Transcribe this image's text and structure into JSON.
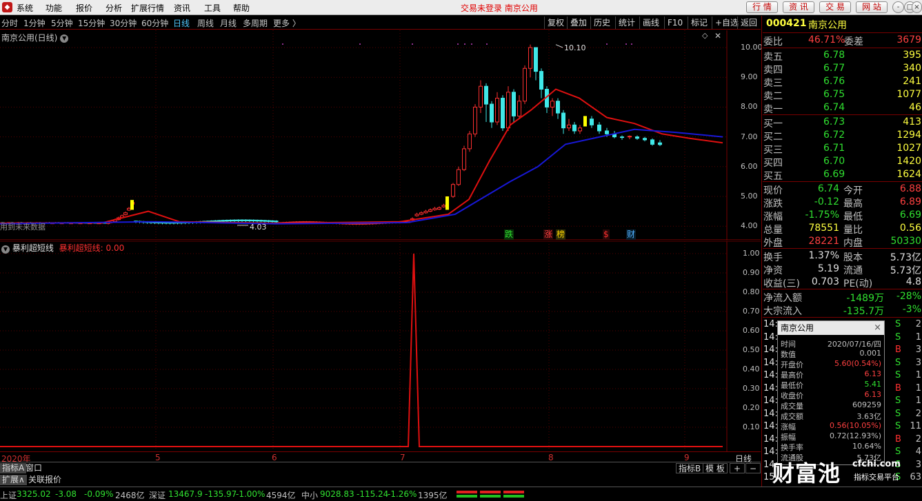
{
  "menubar": {
    "items": [
      "系统",
      "功能",
      "报价",
      "分析",
      "扩展行情",
      "资讯",
      "工具",
      "帮助"
    ],
    "notice": "交易未登录  南京公用",
    "right_buttons": [
      "行 情",
      "资 讯",
      "交 易",
      "网 站"
    ],
    "window_buttons": [
      "-",
      "□",
      "×"
    ]
  },
  "toolbar": {
    "periods": [
      "分时",
      "1分钟",
      "5分钟",
      "15分钟",
      "30分钟",
      "60分钟",
      "日线",
      "周线",
      "月线",
      "多周期",
      "更多 〉"
    ],
    "active_period": "日线",
    "tools": [
      "复权",
      "叠加",
      "历史",
      "统计",
      "画线",
      "F10",
      "标记",
      "+自选",
      "返回"
    ]
  },
  "main_chart": {
    "title": "南京公用(日线)",
    "no_future_data": "用到未来数据",
    "high_label": "10.10",
    "low_label": "4.03",
    "y_labels": [
      "10.00",
      "9.00",
      "8.00",
      "7.00",
      "6.00",
      "5.00",
      "4.00"
    ],
    "event_tags": [
      {
        "text": "跌",
        "color": "#30e030"
      },
      {
        "text": "涨",
        "color": "#ff4040"
      },
      {
        "text": "榜",
        "color": "#ffd700"
      },
      {
        "text": "$",
        "color": "#ff3030"
      },
      {
        "text": "财",
        "color": "#50b0ff"
      }
    ],
    "diamond_icon": "◇",
    "close_icon": "✕"
  },
  "indicator": {
    "name": "暴利超短线",
    "series_label": "暴利超短线: 0.00",
    "y_labels": [
      "1.00",
      "0.90",
      "0.80",
      "0.70",
      "0.60",
      "0.50",
      "0.40",
      "0.30",
      "0.20",
      "0.10"
    ]
  },
  "chart_data": [
    {
      "type": "candlestick",
      "title": "南京公用(日线)",
      "ylim": [
        3.75,
        10.3
      ],
      "ma_colors": {
        "short": "#e01010",
        "long": "#1010d0"
      },
      "annotations": {
        "max": 10.1,
        "min": 4.03
      }
    },
    {
      "type": "line",
      "title": "暴利超短线",
      "ylim": [
        0,
        1.05
      ],
      "peak": 1.0,
      "baseline": 0.0,
      "color": "#e01010"
    }
  ],
  "time_axis": [
    "2020年",
    "5",
    "6",
    "7",
    "8",
    "9"
  ],
  "time_axis_right": "日线",
  "bottom_tabs": [
    "指标A",
    "窗口"
  ],
  "bottom_tabs_right": [
    "指标B",
    "模 板",
    "+",
    "−"
  ],
  "bottom_tabs2": [
    "扩展∧",
    "关联报价"
  ],
  "right_panel": {
    "code": "000421",
    "name": "南京公用",
    "weibi_label": "委比",
    "weibi": "46.71%",
    "weicha_label": "委差",
    "weicha": "3679",
    "sells": [
      {
        "label": "卖五",
        "price": "6.78",
        "vol": "395"
      },
      {
        "label": "卖四",
        "price": "6.77",
        "vol": "340"
      },
      {
        "label": "卖三",
        "price": "6.76",
        "vol": "241"
      },
      {
        "label": "卖二",
        "price": "6.75",
        "vol": "1077"
      },
      {
        "label": "卖一",
        "price": "6.74",
        "vol": "46"
      }
    ],
    "buys": [
      {
        "label": "买一",
        "price": "6.73",
        "vol": "413"
      },
      {
        "label": "买二",
        "price": "6.72",
        "vol": "1294"
      },
      {
        "label": "买三",
        "price": "6.71",
        "vol": "1027"
      },
      {
        "label": "买四",
        "price": "6.70",
        "vol": "1420"
      },
      {
        "label": "买五",
        "price": "6.69",
        "vol": "1624"
      }
    ],
    "quote": [
      {
        "l1": "现价",
        "v1": "6.74",
        "c1": "#30e030",
        "l2": "今开",
        "v2": "6.88",
        "c2": "#ff4040"
      },
      {
        "l1": "涨跌",
        "v1": "-0.12",
        "c1": "#30e030",
        "l2": "最高",
        "v2": "6.89",
        "c2": "#ff4040"
      },
      {
        "l1": "涨幅",
        "v1": "-1.75%",
        "c1": "#30e030",
        "l2": "最低",
        "v2": "6.69",
        "c2": "#30e030"
      },
      {
        "l1": "总量",
        "v1": "78551",
        "c1": "#ffff40",
        "l2": "量比",
        "v2": "0.56",
        "c2": "#ffff40"
      },
      {
        "l1": "外盘",
        "v1": "28221",
        "c1": "#ff4040",
        "l2": "内盘",
        "v2": "50330",
        "c2": "#30e030"
      }
    ],
    "fund": [
      {
        "l1": "换手",
        "v1": "1.37%",
        "l2": "股本",
        "v2": "5.73亿"
      },
      {
        "l1": "净资",
        "v1": "5.19",
        "l2": "流通",
        "v2": "5.73亿"
      },
      {
        "l1": "收益(三)",
        "v1": "0.703",
        "l2": "PE(动)",
        "v2": "4.8"
      }
    ],
    "flow": [
      {
        "label": "净流入额",
        "v1": "-1489万",
        "v2": "-28%"
      },
      {
        "label": "大宗流入",
        "v1": "-135.7万",
        "v2": "-3%"
      }
    ],
    "trades": [
      {
        "t": "14:",
        "s": "S",
        "n": "2"
      },
      {
        "t": "14:",
        "s": "S",
        "n": "1"
      },
      {
        "t": "14:",
        "s": "B",
        "n": "3"
      },
      {
        "t": "14:",
        "s": "S",
        "n": "3"
      },
      {
        "t": "14:",
        "s": "S",
        "n": "1"
      },
      {
        "t": "14:",
        "s": "B",
        "n": "1"
      },
      {
        "t": "14:",
        "s": "S",
        "n": "1"
      },
      {
        "t": "14:",
        "s": "S",
        "n": "2"
      },
      {
        "t": "14:",
        "s": "S",
        "n": "11"
      },
      {
        "t": "14:",
        "s": "B",
        "n": "2"
      },
      {
        "t": "14:",
        "s": "S",
        "n": "4"
      },
      {
        "t": "14:",
        "s": "S",
        "n": "3"
      },
      {
        "t": "15",
        "s": "S",
        "n": "63"
      }
    ]
  },
  "popup": {
    "title": "南京公用",
    "rows": [
      {
        "k": "时间",
        "v": "2020/07/16/四",
        "c": "#c0c0c0"
      },
      {
        "k": "数值",
        "v": "0.001",
        "c": "#c0c0c0"
      },
      {
        "k": "开盘价",
        "v": "5.60(0.54%)",
        "c": "#ff4040"
      },
      {
        "k": "最高价",
        "v": "6.13",
        "c": "#ff4040"
      },
      {
        "k": "最低价",
        "v": "5.41",
        "c": "#30e030"
      },
      {
        "k": "收盘价",
        "v": "6.13",
        "c": "#ff4040"
      },
      {
        "k": "成交量",
        "v": "609259",
        "c": "#c0c0c0"
      },
      {
        "k": "成交额",
        "v": "3.63亿",
        "c": "#c0c0c0"
      },
      {
        "k": "涨幅",
        "v": "0.56(10.05%)",
        "c": "#ff4040"
      },
      {
        "k": "振幅",
        "v": "0.72(12.93%)",
        "c": "#c0c0c0"
      },
      {
        "k": "换手率",
        "v": "10.64%",
        "c": "#c0c0c0"
      },
      {
        "k": "流通股",
        "v": "5.73亿",
        "c": "#c0c0c0"
      }
    ]
  },
  "watermark": {
    "brand": "财富池",
    "site": "cfchi.com",
    "slogan": "指标交易平台"
  },
  "statusbar": {
    "sh_label": "上证",
    "sh_val": "3325.02",
    "sh_chg": "-3.08",
    "sh_pct": "-0.09%",
    "sh_amt": "2468亿",
    "sz_label": "深证",
    "sz_val": "13467.9",
    "sz_chg": "-135.97",
    "sz_pct": "-1.00%",
    "sz_amt": "4594亿",
    "zx_label": "中小",
    "zx_val": "9028.83",
    "zx_chg": "-115.24",
    "zx_pct": "-1.26%",
    "zx_amt": "1395亿"
  }
}
